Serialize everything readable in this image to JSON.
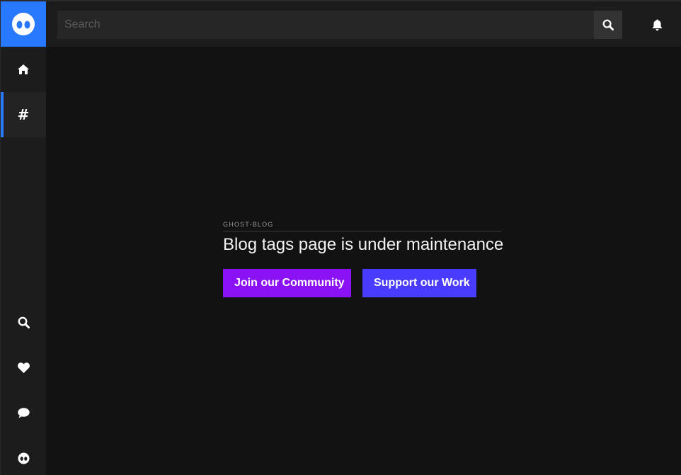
{
  "sidebar": {
    "logo_icon": "ghost-eyes-logo-icon",
    "accent_color": "#2979ff",
    "nav_items": [
      {
        "name": "home",
        "icon": "home-icon"
      },
      {
        "name": "tags",
        "icon": "hash-icon",
        "glyph": "#",
        "active": true
      }
    ],
    "bottom_items": [
      {
        "name": "search",
        "icon": "search-icon"
      },
      {
        "name": "favorites",
        "icon": "heart-icon"
      },
      {
        "name": "comments",
        "icon": "chat-bubble-icon"
      },
      {
        "name": "ghost",
        "icon": "ghost-eyes-icon"
      }
    ]
  },
  "header": {
    "search_placeholder": "Search",
    "search_value": "",
    "search_button_icon": "search-icon",
    "notification_icon": "bell-icon"
  },
  "main": {
    "tag_label": "GHOST-BLOG",
    "heading": "Blog tags page is under maintenance",
    "buttons": {
      "community_label": "Join our Community",
      "community_color": "#8a12f5",
      "support_label": "Support our Work",
      "support_color": "#4a3cff"
    }
  }
}
